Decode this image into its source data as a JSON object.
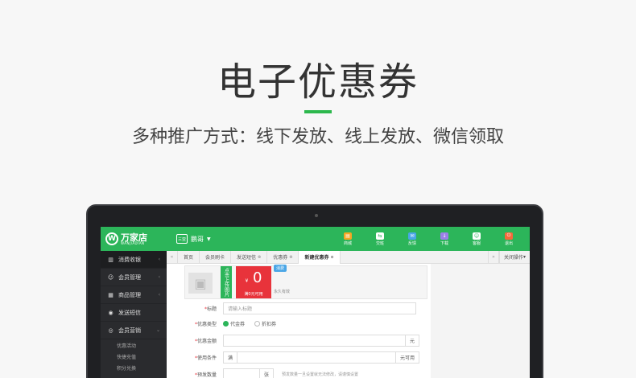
{
  "banner": {
    "title": "电子优惠券",
    "subtitle": "多种推广方式：线下发放、线上发放、微信领取"
  },
  "app": {
    "logo_mark": "W",
    "logo_name": "万家店",
    "logo_sub": "WANJIADIAN",
    "store_icon_text": "三亚",
    "store_name": "鹏哥",
    "toolbar": [
      {
        "label": "商城",
        "color": "#f5a623",
        "glyph": "▤"
      },
      {
        "label": "交班",
        "color": "#ffffff",
        "glyph": "⇆"
      },
      {
        "label": "反馈",
        "color": "#4aa6e6",
        "glyph": "✉"
      },
      {
        "label": "下载",
        "color": "#9b7fe6",
        "glyph": "↓"
      },
      {
        "label": "客服",
        "color": "#ffffff",
        "glyph": "☺"
      },
      {
        "label": "退出",
        "color": "#f5693b",
        "glyph": "⏻"
      }
    ]
  },
  "tabs": {
    "items": [
      "首页",
      "会员刷卡",
      "发送短信",
      "优惠券",
      "新建优惠券"
    ],
    "close": "⊗",
    "close_ops": "关闭操作"
  },
  "sidebar": {
    "items": [
      "消费收银",
      "会员管理",
      "商品管理",
      "发送短信",
      "会员营销"
    ],
    "sub_items": [
      "优惠活动",
      "快捷充值",
      "积分兑换"
    ]
  },
  "coupon": {
    "upload_label": "点击上传图片",
    "currency": "¥",
    "value": "0",
    "condition": "满0元可用",
    "tag": "消费",
    "validity": "永久有效"
  },
  "form": {
    "title_label": "标题",
    "title_placeholder": "请输入标题",
    "type_label": "优惠类型",
    "type_options": [
      "代金券",
      "折扣券"
    ],
    "amount_label": "优惠金额",
    "amount_unit": "元",
    "condition_label": "使用条件",
    "condition_prefix": "满",
    "condition_suffix": "元可用",
    "quantity_label": "预发数量",
    "quantity_unit": "张",
    "quantity_hint": "预发数量一旦设置就无法修改，请谨慎设置"
  }
}
